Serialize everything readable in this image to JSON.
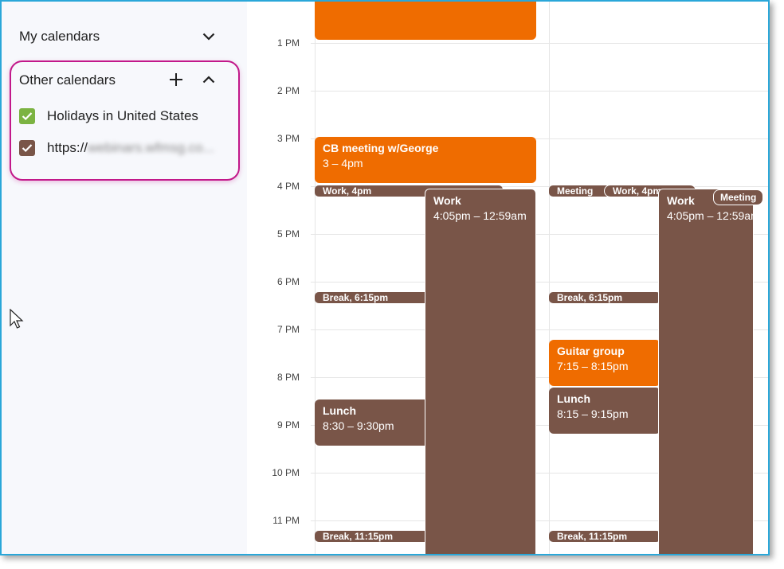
{
  "sidebar": {
    "my_calendars": "My calendars",
    "other_calendars": "Other calendars",
    "items": [
      {
        "label": "Holidays in United States",
        "color": "#7cb342"
      },
      {
        "label": "https://",
        "hidden_part": "webinars.wfmsg.co...",
        "color": "#795548"
      }
    ]
  },
  "times": [
    "1 PM",
    "2 PM",
    "3 PM",
    "4 PM",
    "5 PM",
    "6 PM",
    "7 PM",
    "8 PM",
    "9 PM",
    "10 PM",
    "11 PM"
  ],
  "colors": {
    "orange": "#ef6c00",
    "brown": "#795548",
    "highlight": "#c2188a",
    "frame": "#2aa7d9"
  },
  "col1": {
    "top_event": "",
    "cb_meeting": {
      "title": "CB meeting w/George",
      "time": "3 – 4pm"
    },
    "work_4pm": "Work, 4pm",
    "work": {
      "title": "Work",
      "time": "4:05pm – 12:59am"
    },
    "break1": "Break, 6:15pm",
    "lunch": {
      "title": "Lunch",
      "time": "8:30 – 9:30pm"
    },
    "break2": "Break, 11:15pm"
  },
  "col2": {
    "meeting_pill": "Meeting",
    "work_pill": "Work, 4pm",
    "work": {
      "title": "Work",
      "time": "4:05pm – 12:59am"
    },
    "meeting_chip": "Meeting",
    "break1": "Break, 6:15pm",
    "guitar": {
      "title": "Guitar group",
      "time": "7:15 – 8:15pm"
    },
    "lunch": {
      "title": "Lunch",
      "time": "8:15 – 9:15pm"
    },
    "break2": "Break, 11:15pm"
  }
}
